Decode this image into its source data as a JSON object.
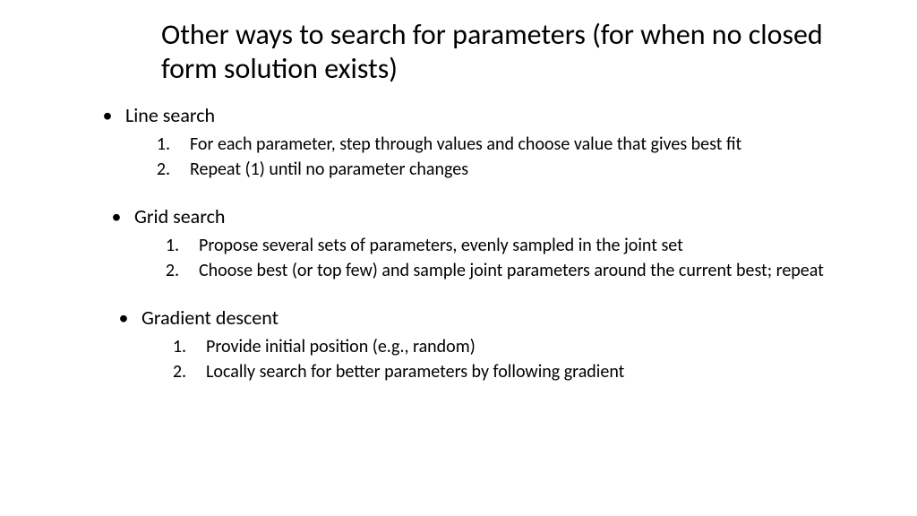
{
  "title": "Other ways to search for parameters (for when no closed form solution exists)",
  "sections": [
    {
      "title": "Line search",
      "items": [
        "For each parameter, step through values and choose value that gives best fit",
        "Repeat (1) until no parameter changes"
      ]
    },
    {
      "title": "Grid search",
      "items": [
        "Propose several sets of parameters, evenly sampled in the joint set",
        "Choose best (or top few) and sample joint parameters around the current best; repeat"
      ]
    },
    {
      "title": "Gradient descent",
      "items": [
        "Provide initial position (e.g., random)",
        "Locally search for better parameters by following gradient"
      ]
    }
  ]
}
